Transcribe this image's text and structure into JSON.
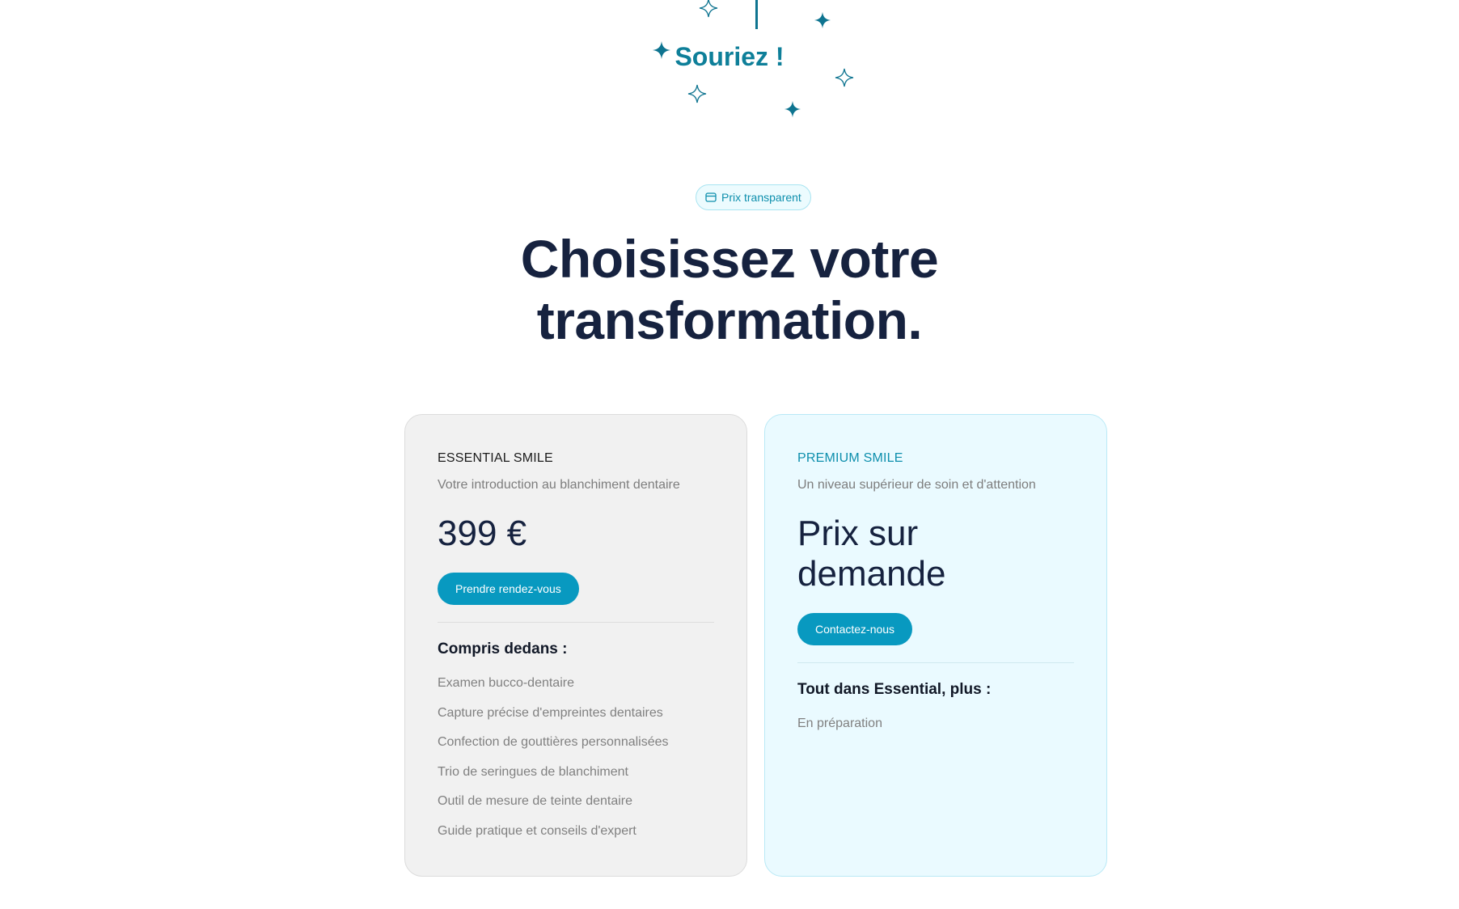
{
  "hero": {
    "text": "Souriez !",
    "accent_color": "#0e7f99",
    "sparkles": [
      "sparkle-outline-icon",
      "sparkle-filled-icon"
    ]
  },
  "badge": {
    "icon": "wallet-icon",
    "label": "Prix transparent"
  },
  "headline": {
    "line1": "Choisissez votre",
    "line2": "transformation."
  },
  "plans": [
    {
      "name": "ESSENTIAL SMILE",
      "description": "Votre introduction au blanchiment dentaire",
      "price": "399 €",
      "cta_label": "Prendre rendez-vous",
      "includes_title": "Compris dedans :",
      "features": [
        "Examen bucco-dentaire",
        "Capture précise d'empreintes dentaires",
        "Confection de gouttières personnalisées",
        "Trio de seringues de blanchiment",
        "Outil de mesure de teinte dentaire",
        "Guide pratique et conseils d'expert"
      ]
    },
    {
      "name": "PREMIUM SMILE",
      "description": "Un niveau supérieur de soin et d'attention",
      "price": "Prix sur demande",
      "cta_label": "Contactez-nous",
      "includes_title": "Tout dans Essential, plus :",
      "features": [
        "En préparation"
      ]
    }
  ],
  "colors": {
    "primary_button": "#0899c0",
    "headline": "#16223f",
    "premium_background": "#eafaff",
    "essential_background": "#f1f1f1"
  }
}
